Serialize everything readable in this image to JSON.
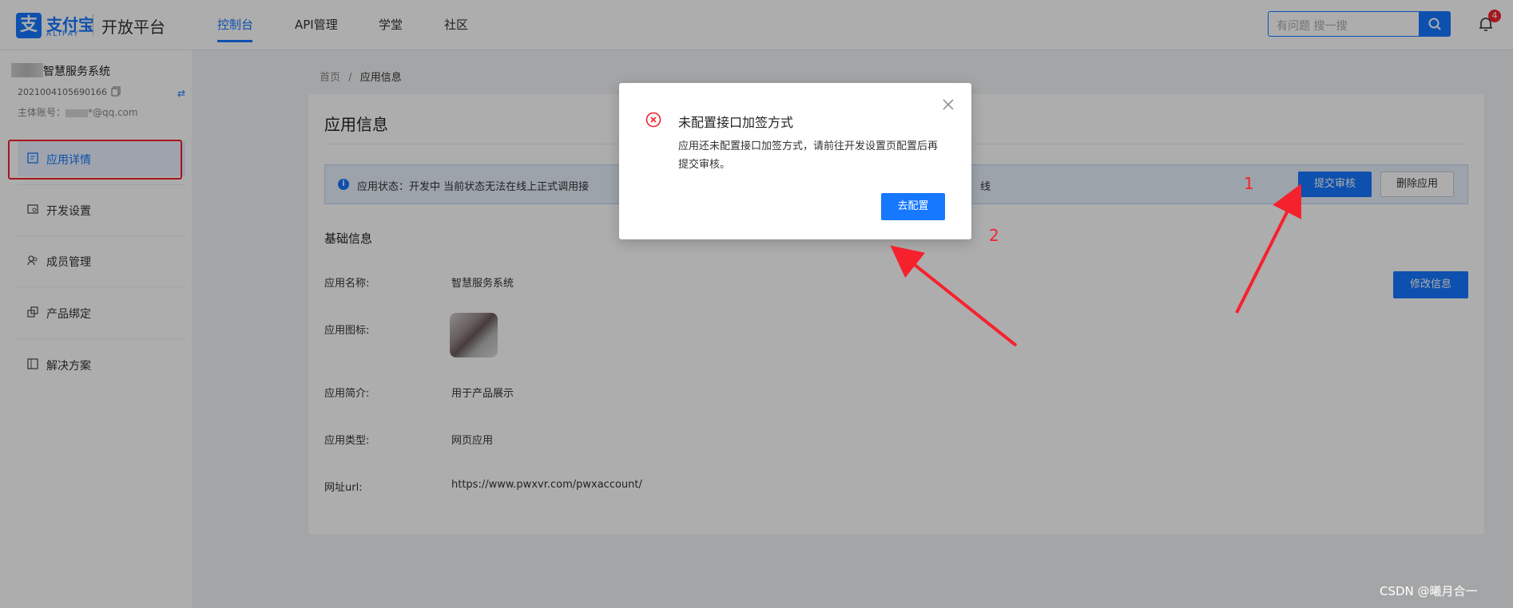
{
  "header": {
    "logo_mark": "支",
    "logo_text": "支付宝",
    "logo_sub": "ALIPAY",
    "platform": "开放平台",
    "nav": [
      "控制台",
      "API管理",
      "学堂",
      "社区"
    ],
    "active_nav": "控制台",
    "search_placeholder": "有问题 搜一搜",
    "notification_count": "4"
  },
  "sidebar": {
    "app_name": "智慧服务系统",
    "app_id": "2021004105690166",
    "account_label": "主体账号：",
    "account_suffix": "*@qq.com",
    "items": [
      {
        "label": "应用详情",
        "icon": "app-detail-icon",
        "active": true
      },
      {
        "label": "开发设置",
        "icon": "dev-settings-icon",
        "active": false
      },
      {
        "label": "成员管理",
        "icon": "members-icon",
        "active": false
      },
      {
        "label": "产品绑定",
        "icon": "product-bind-icon",
        "active": false
      },
      {
        "label": "解决方案",
        "icon": "solution-icon",
        "active": false
      }
    ]
  },
  "breadcrumb": {
    "home": "首页",
    "separator": "/",
    "current": "应用信息"
  },
  "main": {
    "title": "应用信息",
    "alert_text": "应用状态：开发中 当前状态无法在线上正式调用接",
    "alert_tail": "线",
    "submit_button": "提交审核",
    "delete_button": "删除应用",
    "section_title": "基础信息",
    "edit_button": "修改信息",
    "fields": [
      {
        "label": "应用名称:",
        "value": "智慧服务系统"
      },
      {
        "label": "应用图标:",
        "value": ""
      },
      {
        "label": "应用简介:",
        "value": "用于产品展示"
      },
      {
        "label": "应用类型:",
        "value": "网页应用"
      },
      {
        "label": "网址url:",
        "value": "https://www.pwxvr.com/pwxaccount/"
      }
    ]
  },
  "modal": {
    "title": "未配置接口加签方式",
    "body": "应用还未配置接口加签方式，请前往开发设置页配置后再提交审核。",
    "button": "去配置"
  },
  "annotations": {
    "step1": "1",
    "step2": "2"
  },
  "watermark": "CSDN @曦月合一",
  "colors": {
    "brand": "#1677ff",
    "error": "#f5222d",
    "overlay": "rgba(0,0,0,0.32)"
  }
}
